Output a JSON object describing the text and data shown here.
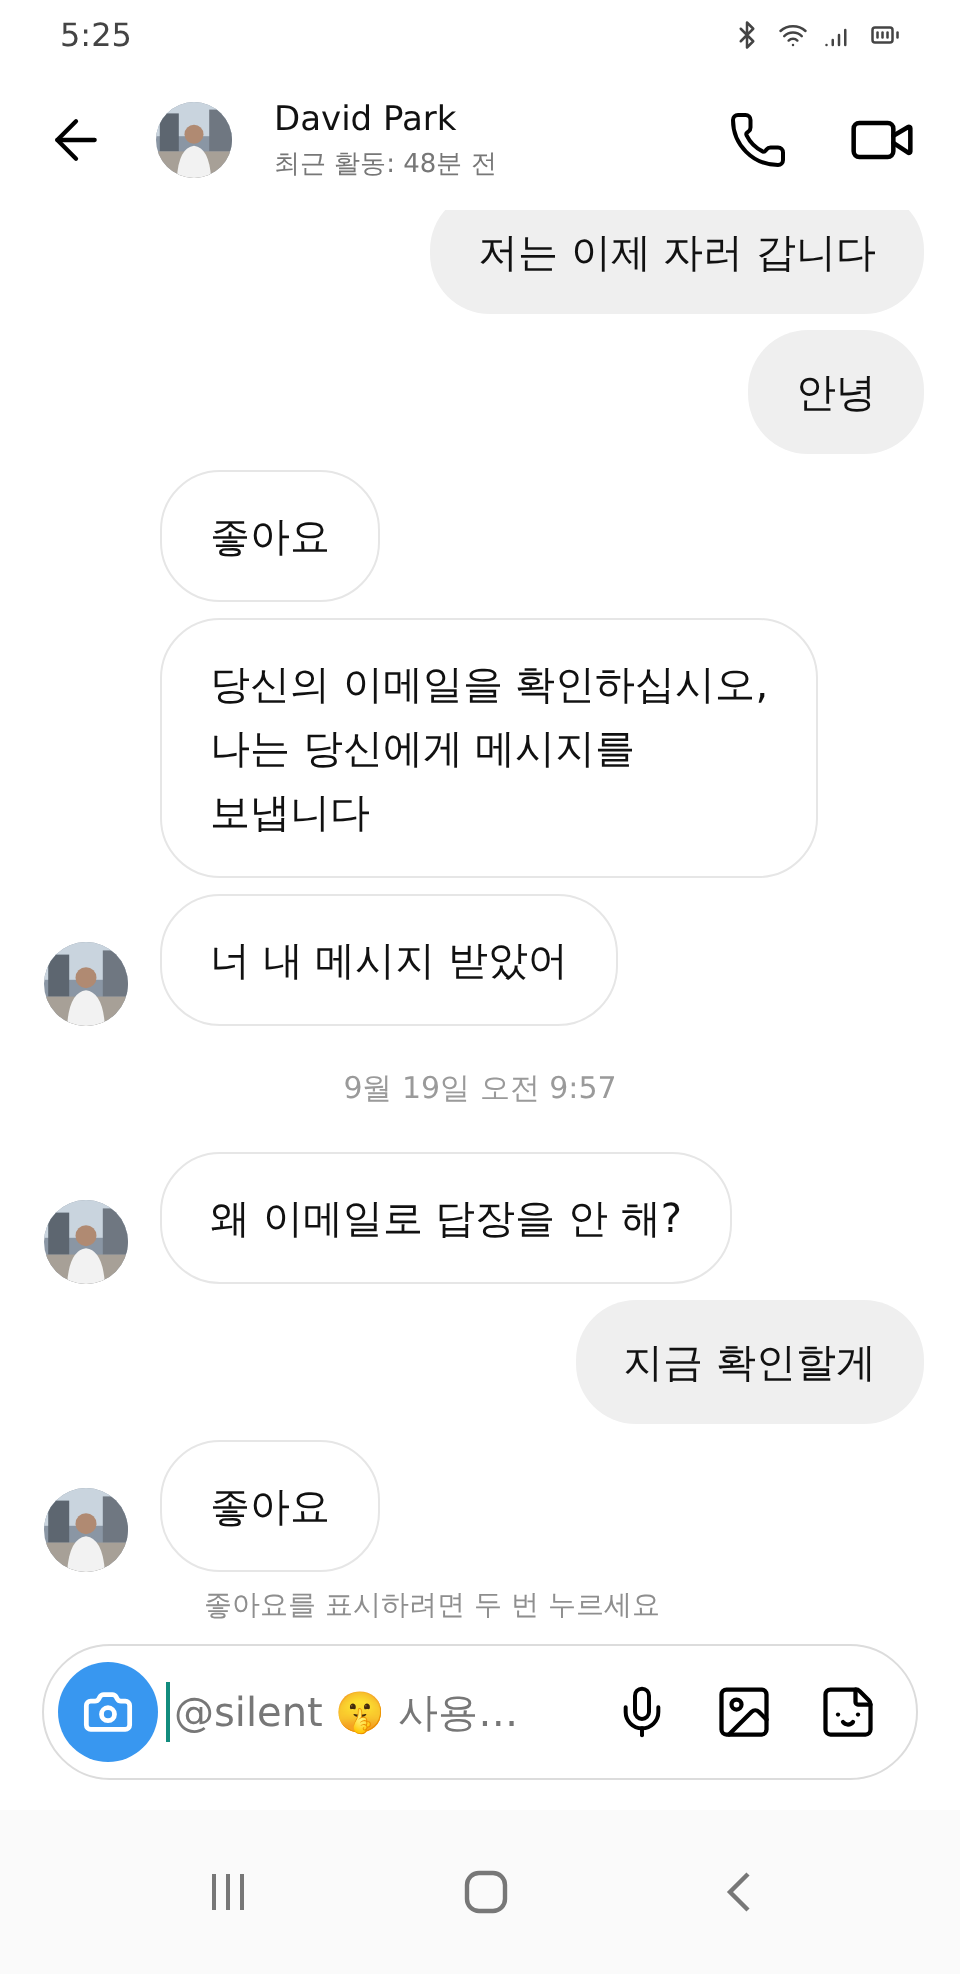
{
  "status_bar": {
    "time": "5:25"
  },
  "header": {
    "name": "David Park",
    "activity": "최근 활동: 48분 전"
  },
  "messages": [
    {
      "kind": "outgoing",
      "text": "저는 이제 자러 갑니다"
    },
    {
      "kind": "outgoing",
      "text": "안녕"
    },
    {
      "kind": "incoming",
      "text": "좋아요",
      "avatar": false
    },
    {
      "kind": "incoming",
      "text": "당신의 이메일을 확인하십시오,\n나는 당신에게 메시지를\n보냅니다",
      "avatar": false
    },
    {
      "kind": "incoming",
      "text": "너 내 메시지 받았어",
      "avatar": true
    },
    {
      "kind": "timestamp",
      "text": "9월 19일 오전 9:57"
    },
    {
      "kind": "incoming",
      "text": "왜 이메일로 답장을 안 해?",
      "avatar": true
    },
    {
      "kind": "outgoing",
      "text": "지금 확인할게"
    },
    {
      "kind": "incoming",
      "text": "좋아요",
      "avatar": true
    },
    {
      "kind": "hint",
      "text": "좋아요를 표시하려면 두 번 누르세요"
    }
  ],
  "composer": {
    "placeholder": "@silent 🤫 사용…"
  }
}
